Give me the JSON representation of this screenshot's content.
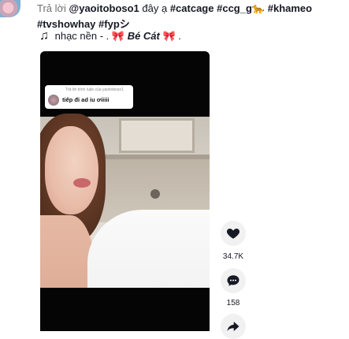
{
  "caption": {
    "prefix": "Trả lời ",
    "reply_user": "@yaoitoboso1",
    "middle": " đây ạ ",
    "tag1": "#catcage",
    "tag2": "#ccg_g",
    "emoji1": "🐆",
    "tag3": "#khameo",
    "line2_tag1": "#tvshowhay",
    "line2_tag2": "#fypシ"
  },
  "music": {
    "note": "♫",
    "text_a": " nhạc nền - . ",
    "bow": "🎀",
    "name": " Bé Cát ",
    "bow2": "🎀",
    "end": " ."
  },
  "video": {
    "comment_reply_title": "Trả lời bình luận của yaoitoboso1",
    "comment_text": "tiếp đi ad iu ơiiiii"
  },
  "actions": {
    "like_count": "34.7K",
    "comment_count": "158"
  }
}
